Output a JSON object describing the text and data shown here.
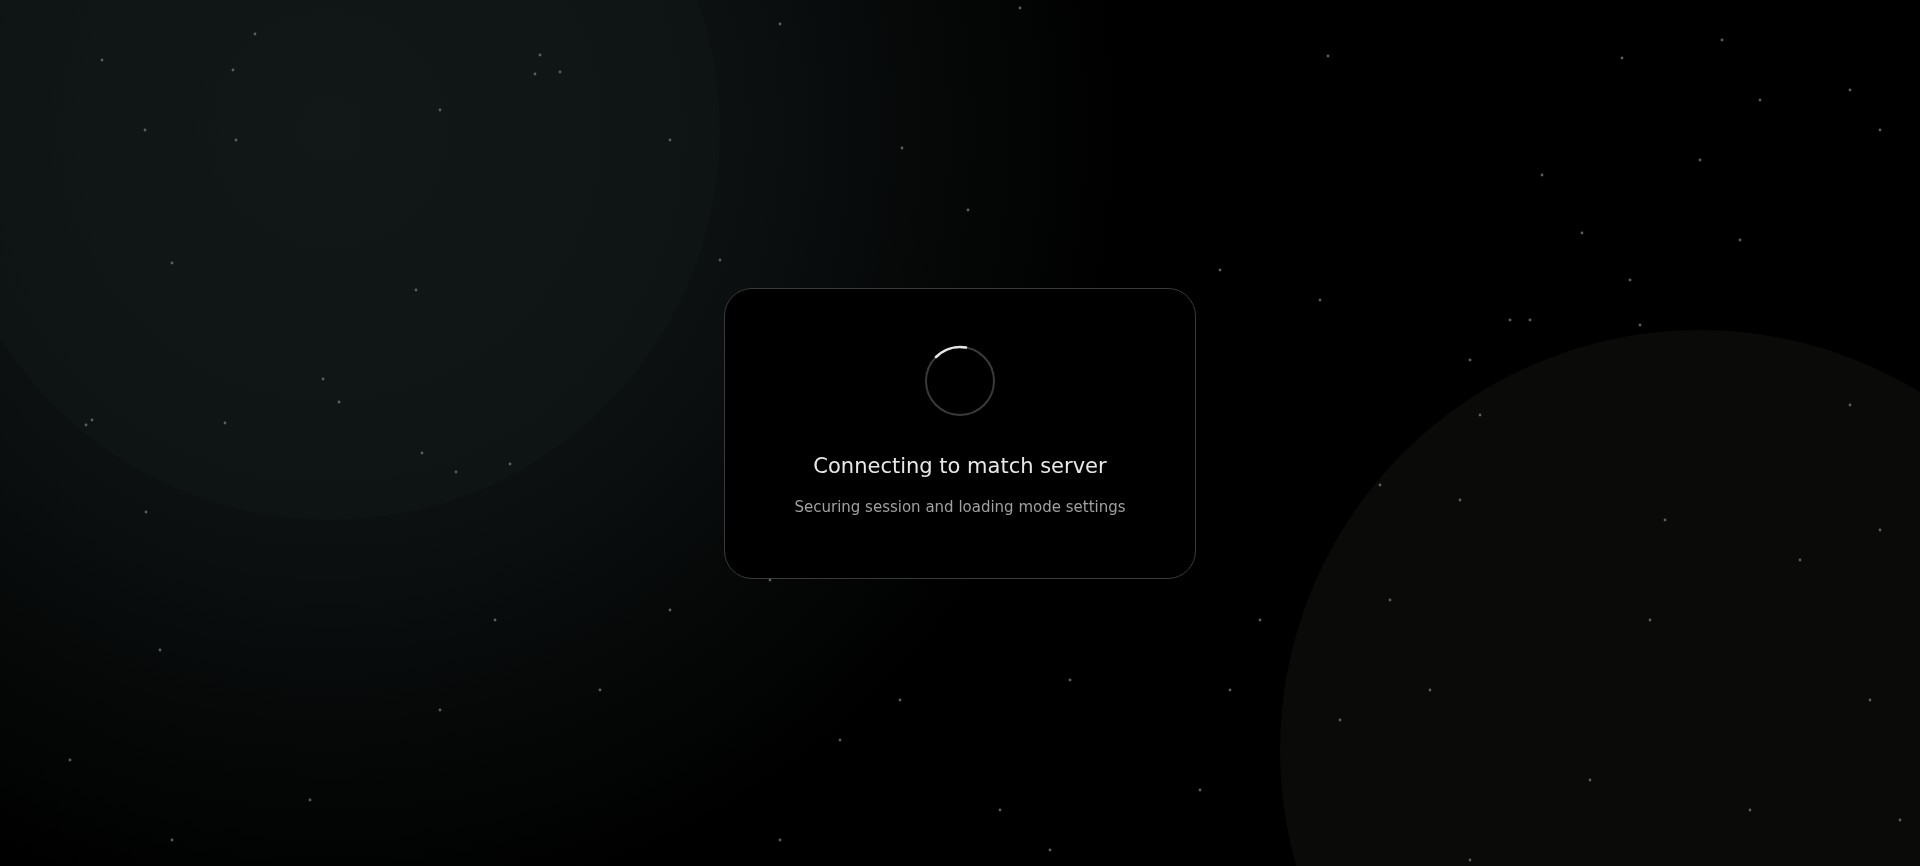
{
  "loading_card": {
    "title": "Connecting to match server",
    "subtitle": "Securing session and loading mode settings"
  }
}
